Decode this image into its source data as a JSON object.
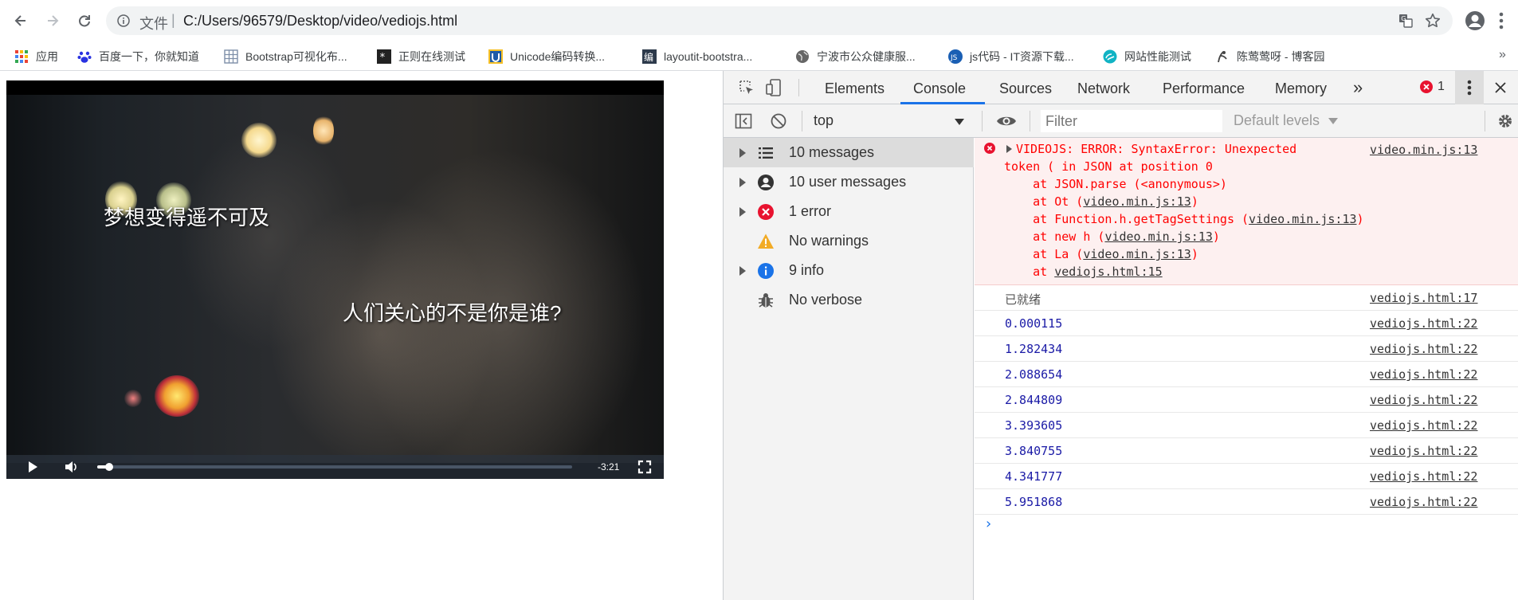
{
  "browser": {
    "scheme_label": "文件",
    "url": "C:/Users/96579/Desktop/video/vediojs.html"
  },
  "bookmarks": [
    {
      "label": "应用",
      "icon": "apps-grid-icon"
    },
    {
      "label": "百度一下，你就知道",
      "icon": "baidu-paw-icon"
    },
    {
      "label": "Bootstrap可视化布...",
      "icon": "grid-layout-icon"
    },
    {
      "label": "正则在线测试",
      "icon": "regex-icon"
    },
    {
      "label": "Unicode编码转换...",
      "icon": "unicode-icon"
    },
    {
      "label": "layoutit-bootstra...",
      "icon": "layoutit-icon"
    },
    {
      "label": "宁波市公众健康服...",
      "icon": "globe-icon"
    },
    {
      "label": "js代码 - IT资源下载...",
      "icon": "js-icon"
    },
    {
      "label": "网站性能测试",
      "icon": "speed-test-icon"
    },
    {
      "label": "陈莺莺呀 - 博客园",
      "icon": "cnblogs-icon"
    }
  ],
  "video": {
    "subtitle_top": "梦想变得遥不可及",
    "subtitle_bottom": "人们关心的不是你是谁?",
    "remaining_time": "-3:21",
    "progress_fraction": 0.025
  },
  "devtools": {
    "tabs": [
      "Elements",
      "Console",
      "Sources",
      "Network",
      "Performance",
      "Memory"
    ],
    "active_tab": "Console",
    "more_tabs": "»",
    "error_count": "1",
    "context": "top",
    "filter_placeholder": "Filter",
    "levels": "Default levels",
    "sidebar": [
      {
        "label": "10 messages",
        "icon": "list-icon",
        "expandable": true,
        "selected": true
      },
      {
        "label": "10 user messages",
        "icon": "user-icon",
        "expandable": true
      },
      {
        "label": "1 error",
        "icon": "error-icon",
        "expandable": true
      },
      {
        "label": "No warnings",
        "icon": "warning-icon",
        "expandable": false
      },
      {
        "label": "9 info",
        "icon": "info-icon",
        "expandable": true
      },
      {
        "label": "No verbose",
        "icon": "bug-icon",
        "expandable": false
      }
    ],
    "error": {
      "line1": "VIDEOJS: ERROR: SyntaxError: Unexpected",
      "line2": "token ( in JSON at position 0",
      "stack": [
        {
          "prefix": "    at JSON.parse (<anonymous>)",
          "link": "",
          "suffix": ""
        },
        {
          "prefix": "    at Ot (",
          "link": "video.min.js:13",
          "suffix": ")"
        },
        {
          "prefix": "    at Function.h.getTagSettings (",
          "link": "video.min.js:13",
          "suffix": ")"
        },
        {
          "prefix": "    at new h (",
          "link": "video.min.js:13",
          "suffix": ")"
        },
        {
          "prefix": "    at La (",
          "link": "video.min.js:13",
          "suffix": ")"
        },
        {
          "prefix": "    at ",
          "link": "vediojs.html:15",
          "suffix": ""
        }
      ],
      "source": "video.min.js:13"
    },
    "logs": [
      {
        "value": "已就绪",
        "source": "vediojs.html:17",
        "kind": "string"
      },
      {
        "value": "0.000115",
        "source": "vediojs.html:22",
        "kind": "number"
      },
      {
        "value": "1.282434",
        "source": "vediojs.html:22",
        "kind": "number"
      },
      {
        "value": "2.088654",
        "source": "vediojs.html:22",
        "kind": "number"
      },
      {
        "value": "2.844809",
        "source": "vediojs.html:22",
        "kind": "number"
      },
      {
        "value": "3.393605",
        "source": "vediojs.html:22",
        "kind": "number"
      },
      {
        "value": "3.840755",
        "source": "vediojs.html:22",
        "kind": "number"
      },
      {
        "value": "4.341777",
        "source": "vediojs.html:22",
        "kind": "number"
      },
      {
        "value": "5.951868",
        "source": "vediojs.html:22",
        "kind": "number"
      }
    ],
    "prompt": "›"
  },
  "colors": {
    "error_text": "#ff0000",
    "error_bg": "#fdf0f0",
    "number_value": "#1a1aa6",
    "string_value": "#555555",
    "accent": "#1a73e8"
  }
}
